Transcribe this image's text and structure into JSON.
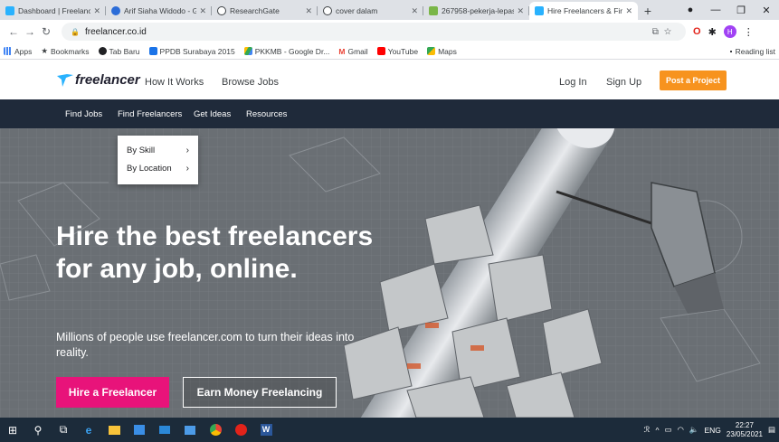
{
  "browser": {
    "tabs": [
      {
        "title": "Dashboard | Freelance",
        "color": "#29b2fe",
        "active": false
      },
      {
        "title": "Arif Siaha Widodo - G",
        "color": "#2b6cd8",
        "active": false
      },
      {
        "title": "ResearchGate",
        "color": "#3c4043",
        "active": false
      },
      {
        "title": "cover dalam",
        "color": "#3c4043",
        "active": false
      },
      {
        "title": "267958-pekerja-lepas",
        "color": "#7ab648",
        "active": false
      },
      {
        "title": "Hire Freelancers & Fin",
        "color": "#29b2fe",
        "active": true
      }
    ],
    "new_tab": "+",
    "url": "freelancer.co.id"
  },
  "bookmarks": {
    "items": [
      {
        "label": "Apps",
        "color": "#4285f4"
      },
      {
        "label": "Bookmarks",
        "color": "#202124"
      },
      {
        "label": "Tab Baru",
        "color": "#202124"
      },
      {
        "label": "PPDB Surabaya 2015",
        "color": "#1a73e8"
      },
      {
        "label": "PKKMB - Google Dr...",
        "color": "#34a853"
      },
      {
        "label": "Gmail",
        "color": "#ea4335"
      },
      {
        "label": "YouTube",
        "color": "#ff0000"
      },
      {
        "label": "Maps",
        "color": "#34a853"
      }
    ],
    "reading_list": "Reading list"
  },
  "site": {
    "logo_text": "freelancer",
    "header_links": {
      "how_it_works": "How It Works",
      "browse_jobs": "Browse Jobs",
      "log_in": "Log In",
      "sign_up": "Sign Up",
      "post_project": "Post a Project"
    },
    "subnav": {
      "find_jobs": "Find Jobs",
      "find_freelancers": "Find Freelancers",
      "get_ideas": "Get Ideas",
      "resources": "Resources"
    },
    "dropdown": {
      "by_skill": "By Skill",
      "by_location": "By Location"
    },
    "hero": {
      "title": "Hire the best freelancers for any job, online.",
      "subtitle": "Millions of people use freelancer.com to turn their ideas into reality.",
      "hire_button": "Hire a Freelancer",
      "earn_button": "Earn Money Freelancing"
    },
    "colors": {
      "accent_orange": "#f7931e",
      "hire_pink": "#e8137a",
      "nav_dark": "#1f2a3a",
      "brand_blue": "#29b2fe"
    }
  },
  "taskbar": {
    "language": "ENG",
    "time": "22:27",
    "date": "23/05/2021"
  }
}
